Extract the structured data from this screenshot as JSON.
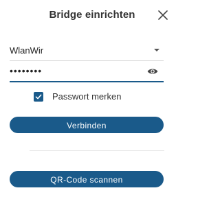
{
  "dialog": {
    "title": "Bridge einrichten",
    "close_icon": "close-icon"
  },
  "form": {
    "ssid_value": "WlanWir",
    "password_value": "••••••••",
    "remember_label": "Passwort merken",
    "remember_checked": true
  },
  "actions": {
    "connect_label": "Verbinden",
    "qr_label": "QR-Code scannen"
  },
  "colors": {
    "accent": "#1a5a8a",
    "divider": "#e6e6e6"
  }
}
